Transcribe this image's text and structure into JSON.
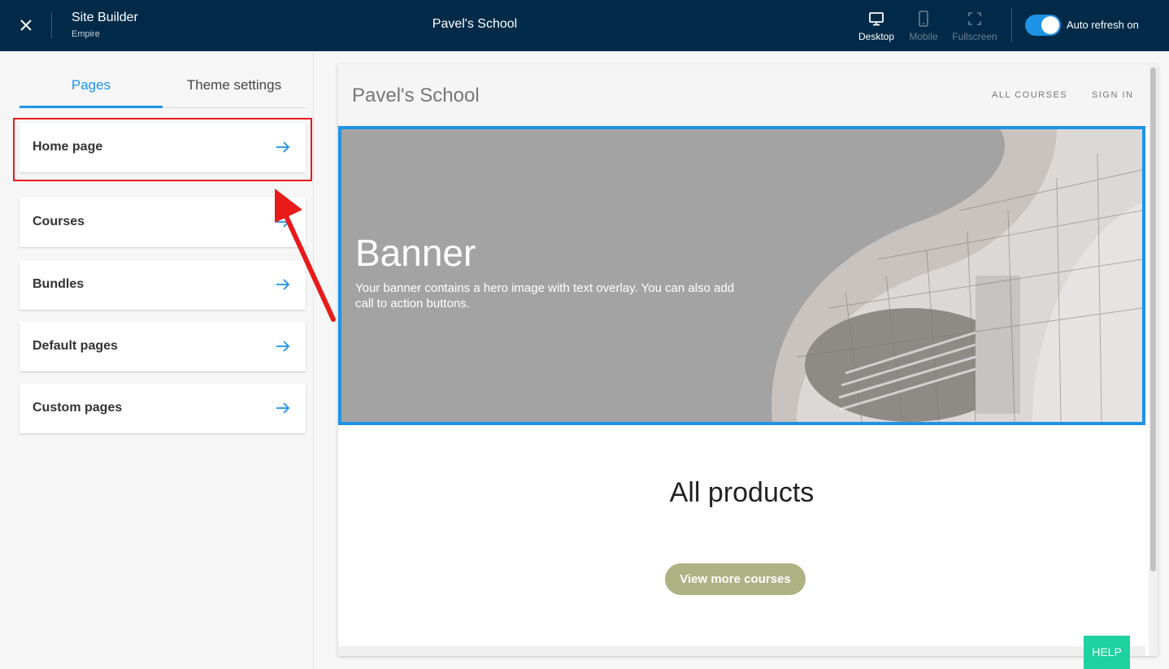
{
  "topbar": {
    "app_title": "Site Builder",
    "app_subtitle": "Empire",
    "school_title": "Pavel's School",
    "views": {
      "desktop": "Desktop",
      "mobile": "Mobile",
      "fullscreen": "Fullscreen"
    },
    "auto_refresh_label": "Auto refresh on",
    "auto_refresh_on": true
  },
  "sidebar": {
    "tabs": {
      "pages": "Pages",
      "theme_settings": "Theme settings"
    },
    "items": [
      {
        "label": "Home page"
      },
      {
        "label": "Courses"
      },
      {
        "label": "Bundles"
      },
      {
        "label": "Default pages"
      },
      {
        "label": "Custom pages"
      }
    ]
  },
  "preview": {
    "site_name": "Pavel's School",
    "nav": {
      "all_courses": "ALL COURSES",
      "sign_in": "SIGN IN"
    },
    "banner": {
      "title": "Banner",
      "text": "Your banner contains a hero image with text overlay. You can also add call to action buttons."
    },
    "products_title": "All products",
    "view_more_button": "View more courses"
  },
  "help_button": "HELP",
  "colors": {
    "topbar_bg": "#002a48",
    "accent": "#1e93e6",
    "annotation": "#e81a1a",
    "button_olive": "#aeb283",
    "help_green": "#1ed2a0"
  },
  "icons": [
    "close-icon",
    "desktop-icon",
    "mobile-icon",
    "fullscreen-icon",
    "arrow-right-icon"
  ]
}
